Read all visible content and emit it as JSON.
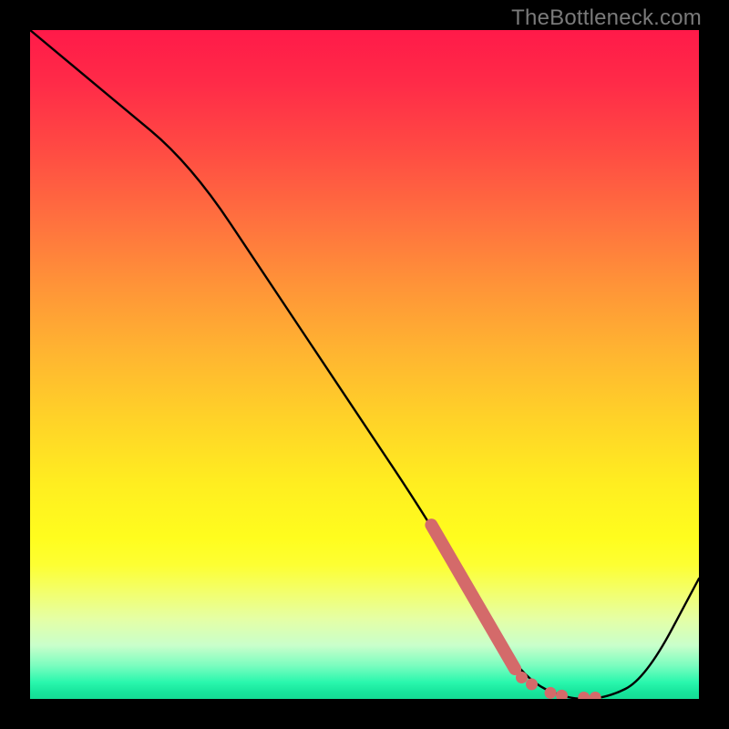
{
  "watermark": "TheBottleneck.com",
  "chart_data": {
    "type": "line",
    "title": "",
    "xlabel": "",
    "ylabel": "",
    "xlim": [
      0,
      100
    ],
    "ylim": [
      0,
      100
    ],
    "grid": false,
    "series": [
      {
        "name": "curve",
        "color": "#000000",
        "x": [
          0,
          12,
          24,
          36,
          48,
          60,
          68,
          74,
          80,
          86,
          92,
          100
        ],
        "y": [
          100,
          90,
          80,
          62,
          44,
          26,
          12,
          3,
          0,
          0,
          3,
          18
        ]
      }
    ],
    "highlight": {
      "color": "#d46a6a",
      "thick_segment": {
        "x": [
          60,
          72.5
        ],
        "y": [
          26,
          4.5
        ]
      },
      "dots": [
        {
          "x": 73.5,
          "y": 3.2
        },
        {
          "x": 75.0,
          "y": 2.2
        },
        {
          "x": 77.8,
          "y": 0.9
        },
        {
          "x": 79.5,
          "y": 0.5
        },
        {
          "x": 82.8,
          "y": 0.2
        },
        {
          "x": 84.5,
          "y": 0.2
        }
      ]
    },
    "background_gradient": {
      "top": "#ff1a49",
      "mid": "#ffee20",
      "bottom": "#15dc95"
    }
  }
}
